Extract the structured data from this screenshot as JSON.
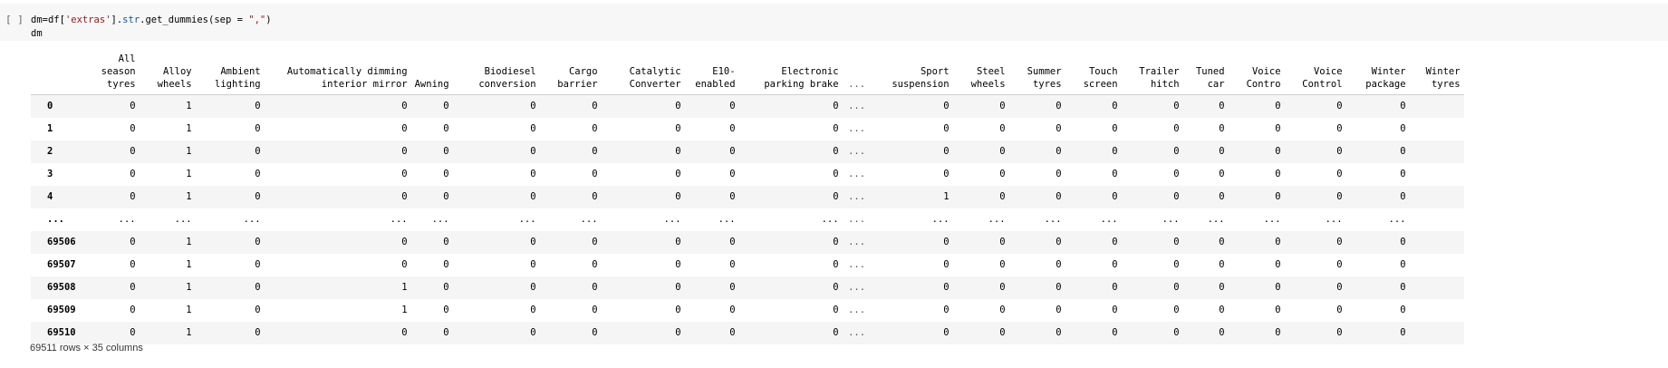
{
  "cell": {
    "run_indicator": "[ ]",
    "code_line1_pre": "dm=df[",
    "code_line1_str1": "'extras'",
    "code_line1_mid": "].",
    "code_line1_attr": "str",
    "code_line1_post": ".get_dummies(sep = ",
    "code_line1_str2": "\",\"",
    "code_line1_end": ")",
    "code_line2": "dm"
  },
  "table": {
    "columns": [
      "All season tyres",
      "Alloy wheels",
      "Ambient lighting",
      "Automatically dimming interior mirror",
      "Awning",
      "Biodiesel conversion",
      "Cargo barrier",
      "Catalytic Converter",
      "E10-enabled",
      "Electronic parking brake",
      "...",
      "Sport suspension",
      "Steel wheels",
      "Summer tyres",
      "Touch screen",
      "Trailer hitch",
      "Tuned car",
      "Voice Contro",
      "Voice Control",
      "Winter package",
      "Winter tyres"
    ],
    "rows": [
      {
        "index": "0",
        "values": [
          "0",
          "1",
          "0",
          "0",
          "0",
          "0",
          "0",
          "0",
          "0",
          "0",
          "...",
          "0",
          "0",
          "0",
          "0",
          "0",
          "0",
          "0",
          "0",
          "0",
          ""
        ]
      },
      {
        "index": "1",
        "values": [
          "0",
          "1",
          "0",
          "0",
          "0",
          "0",
          "0",
          "0",
          "0",
          "0",
          "...",
          "0",
          "0",
          "0",
          "0",
          "0",
          "0",
          "0",
          "0",
          "0",
          ""
        ]
      },
      {
        "index": "2",
        "values": [
          "0",
          "1",
          "0",
          "0",
          "0",
          "0",
          "0",
          "0",
          "0",
          "0",
          "...",
          "0",
          "0",
          "0",
          "0",
          "0",
          "0",
          "0",
          "0",
          "0",
          ""
        ]
      },
      {
        "index": "3",
        "values": [
          "0",
          "1",
          "0",
          "0",
          "0",
          "0",
          "0",
          "0",
          "0",
          "0",
          "...",
          "0",
          "0",
          "0",
          "0",
          "0",
          "0",
          "0",
          "0",
          "0",
          ""
        ]
      },
      {
        "index": "4",
        "values": [
          "0",
          "1",
          "0",
          "0",
          "0",
          "0",
          "0",
          "0",
          "0",
          "0",
          "...",
          "1",
          "0",
          "0",
          "0",
          "0",
          "0",
          "0",
          "0",
          "0",
          ""
        ]
      },
      {
        "index": "...",
        "values": [
          "...",
          "...",
          "...",
          "...",
          "...",
          "...",
          "...",
          "...",
          "...",
          "...",
          "...",
          "...",
          "...",
          "...",
          "...",
          "...",
          "...",
          "...",
          "...",
          "...",
          ""
        ]
      },
      {
        "index": "69506",
        "values": [
          "0",
          "1",
          "0",
          "0",
          "0",
          "0",
          "0",
          "0",
          "0",
          "0",
          "...",
          "0",
          "0",
          "0",
          "0",
          "0",
          "0",
          "0",
          "0",
          "0",
          ""
        ]
      },
      {
        "index": "69507",
        "values": [
          "0",
          "1",
          "0",
          "0",
          "0",
          "0",
          "0",
          "0",
          "0",
          "0",
          "...",
          "0",
          "0",
          "0",
          "0",
          "0",
          "0",
          "0",
          "0",
          "0",
          ""
        ]
      },
      {
        "index": "69508",
        "values": [
          "0",
          "1",
          "0",
          "1",
          "0",
          "0",
          "0",
          "0",
          "0",
          "0",
          "...",
          "0",
          "0",
          "0",
          "0",
          "0",
          "0",
          "0",
          "0",
          "0",
          ""
        ]
      },
      {
        "index": "69509",
        "values": [
          "0",
          "1",
          "0",
          "1",
          "0",
          "0",
          "0",
          "0",
          "0",
          "0",
          "...",
          "0",
          "0",
          "0",
          "0",
          "0",
          "0",
          "0",
          "0",
          "0",
          ""
        ]
      },
      {
        "index": "69510",
        "values": [
          "0",
          "1",
          "0",
          "0",
          "0",
          "0",
          "0",
          "0",
          "0",
          "0",
          "...",
          "0",
          "0",
          "0",
          "0",
          "0",
          "0",
          "0",
          "0",
          "0",
          ""
        ]
      }
    ],
    "footer": "69511 rows × 35 columns"
  }
}
